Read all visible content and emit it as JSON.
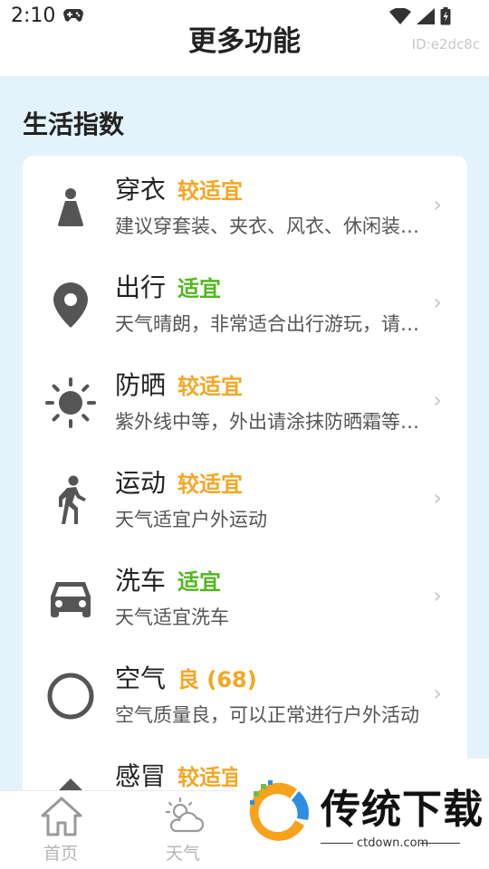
{
  "status": {
    "time": "2:10"
  },
  "header": {
    "title": "更多功能",
    "device_id": "ID:e2dc8c"
  },
  "section": {
    "title": "生活指数"
  },
  "indices": [
    {
      "name": "穿衣",
      "level": "较适宜",
      "level_color": "#f5a623",
      "desc": "建议穿套装、夹衣、风衣、休闲装、夹克衫、西装或薄毛衣等",
      "icon": "clothing-icon"
    },
    {
      "name": "出行",
      "level": "适宜",
      "level_color": "#52b81e",
      "desc": "天气晴朗，非常适合出行游玩，请注意安全",
      "icon": "location-pin-icon"
    },
    {
      "name": "防晒",
      "level": "较适宜",
      "level_color": "#f5a623",
      "desc": "紫外线中等，外出请涂抹防晒霜等防护用品",
      "icon": "sun-icon"
    },
    {
      "name": "运动",
      "level": "较适宜",
      "level_color": "#f5a623",
      "desc": "天气适宜户外运动",
      "icon": "walking-person-icon"
    },
    {
      "name": "洗车",
      "level": "适宜",
      "level_color": "#52b81e",
      "desc": "天气适宜洗车",
      "icon": "car-icon"
    },
    {
      "name": "空气",
      "level": "良 (68)",
      "level_color": "#f5a623",
      "desc": "空气质量良，可以正常进行户外活动",
      "icon": "air-circle-icon"
    },
    {
      "name": "感冒",
      "level": "较适宜",
      "level_color": "#f5a623",
      "desc": "",
      "icon": "cold-icon"
    }
  ],
  "tabs": [
    {
      "label": "首页",
      "icon": "home-icon"
    },
    {
      "label": "天气",
      "icon": "weather-icon"
    }
  ],
  "watermark": {
    "text": "传统下载",
    "url": "ctdown.com"
  },
  "colors": {
    "background": "#e4f3fb",
    "icon_gray": "#555555",
    "orange": "#f5a623",
    "green": "#52b81e"
  }
}
